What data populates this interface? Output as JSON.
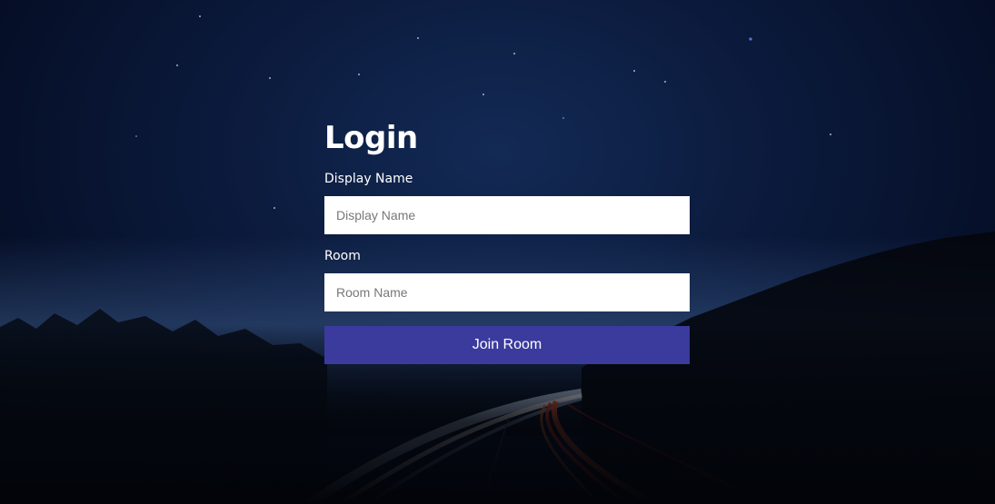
{
  "login": {
    "title": "Login",
    "display_name_label": "Display Name",
    "display_name_placeholder": "Display Name",
    "display_name_value": "",
    "room_label": "Room",
    "room_placeholder": "Room Name",
    "room_value": "",
    "join_button_label": "Join Room"
  },
  "colors": {
    "button_bg": "#3a3b9d",
    "background_sky": "#0b1a3c",
    "text": "#ffffff"
  }
}
